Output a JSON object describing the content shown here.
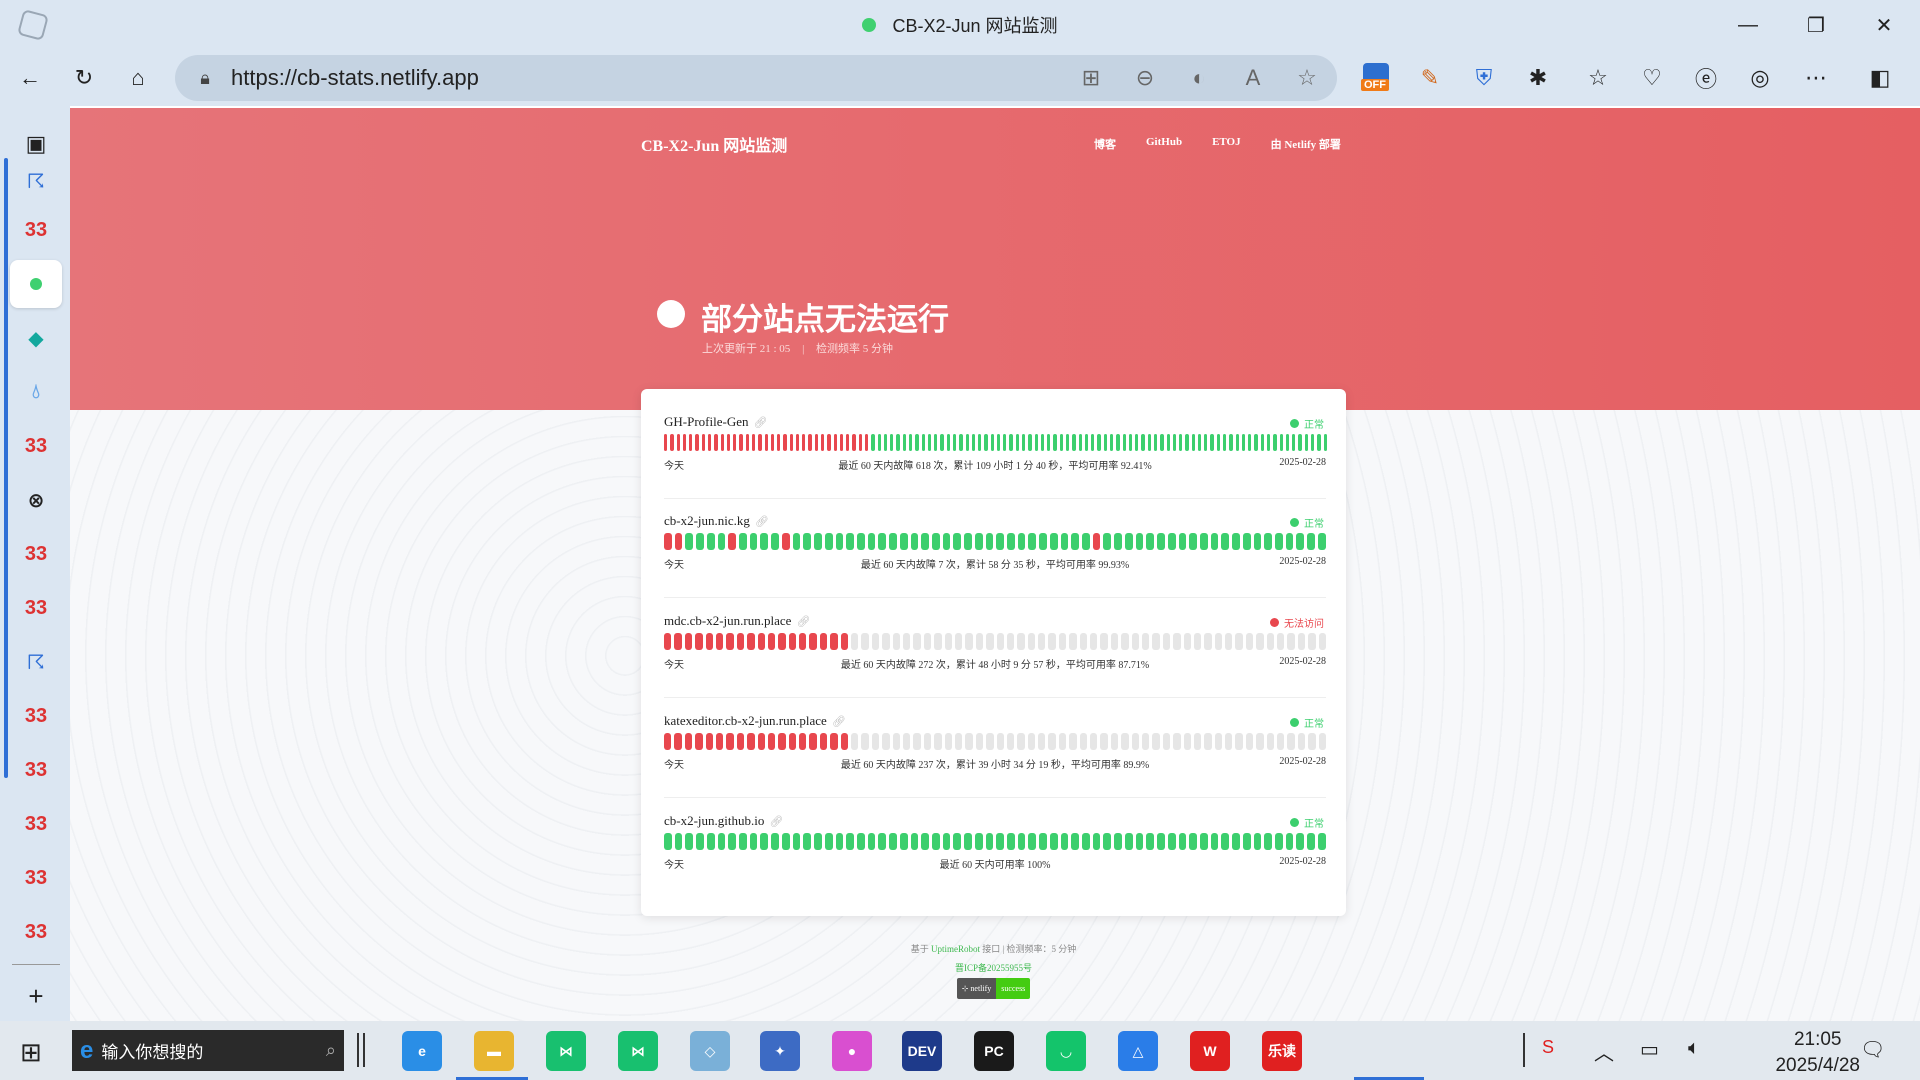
{
  "window": {
    "title": "CB-X2-Jun 网站监测",
    "minimize": "—",
    "restore": "❐",
    "close": "✕"
  },
  "toolbar": {
    "url": "https://cb-stats.netlify.app",
    "ext_off_badge": "OFF"
  },
  "site_header": {
    "brand": "CB-X2-Jun 网站监测",
    "nav": [
      "博客",
      "GitHub",
      "ETOJ",
      "由 Netlify 部署"
    ]
  },
  "overall": {
    "title": "部分站点无法运行",
    "last_update": "上次更新于 21 : 05",
    "separator": "|",
    "frequency": "检测频率 5 分钟"
  },
  "colors": {
    "up": "#3ccf6e",
    "down": "#e8474e",
    "nodata": "#e6e6e6",
    "header_start": "#e67479",
    "header_end": "#e55f62"
  },
  "monitors": [
    {
      "name": "GH-Profile-Gen",
      "status": "正常",
      "status_color": "#3ccf6e",
      "left": "今天",
      "summary": "最近 60 天内故障 618 次，累计 109 小时 1 分 40 秒，平均可用率 92.41%",
      "right": "2025-02-28",
      "bars": "ddddddddddddddddddddddddddddddddduuuuuuuuuuuuuuuuuuuuuuuuuuuuuuuuuuuuuuuuuuuuuuuuuuuuuuuuuuuuuuuuuuuuuuuuu"
    },
    {
      "name": "cb-x2-jun.nic.kg",
      "status": "正常",
      "status_color": "#3ccf6e",
      "left": "今天",
      "summary": "最近 60 天内故障 7 次，累计 58 分 35 秒，平均可用率 99.93%",
      "right": "2025-02-28",
      "bars": "dduuuuduuuuduuuuuuuuuuuuuuuuuuuuuuuuuuuuduuuuuuuuuuuuuuuuuuuuu"
    },
    {
      "name": "mdc.cb-x2-jun.run.place",
      "status": "无法访问",
      "status_color": "#e8474e",
      "left": "今天",
      "summary": "最近 60 天内故障 272 次，累计 48 小时 9 分 57 秒，平均可用率 87.71%",
      "right": "2025-02-28",
      "bars": "ddddddddddddddddddnnnnnnnnnnnnnnnnnnnnnnnnnnnnnnnnnnnnnnnnnnnnnn"
    },
    {
      "name": "katexeditor.cb-x2-jun.run.place",
      "status": "正常",
      "status_color": "#3ccf6e",
      "left": "今天",
      "summary": "最近 60 天内故障 237 次，累计 39 小时 34 分 19 秒，平均可用率 89.9%",
      "right": "2025-02-28",
      "bars": "ddddddddddddddddddnnnnnnnnnnnnnnnnnnnnnnnnnnnnnnnnnnnnnnnnnnnnnn"
    },
    {
      "name": "cb-x2-jun.github.io",
      "status": "正常",
      "status_color": "#3ccf6e",
      "left": "今天",
      "summary": "最近 60 天内可用率 100%",
      "right": "2025-02-28",
      "bars": "uuuuuuuuuuuuuuuuuuuuuuuuuuuuuuuuuuuuuuuuuuuuuuuuuuuuuuuuuuuuuu"
    }
  ],
  "page_footer": {
    "line1_prefix": "基于",
    "line1_link": "UptimeRobot",
    "line1_suffix": "接口 | 检测频率：5 分钟",
    "icp": "晋ICP备20255955号",
    "badge_left": "⊹ netlify",
    "badge_right": "success"
  },
  "taskbar": {
    "search_placeholder": "输入你想搜的",
    "time": "21:05",
    "date": "2025/4/28",
    "apps": [
      {
        "label": "e",
        "color": "#2a8ee6"
      },
      {
        "label": "▬",
        "color": "#e8b530"
      },
      {
        "label": "⋈",
        "color": "#18c06f"
      },
      {
        "label": "⋈",
        "color": "#18c06f"
      },
      {
        "label": "◇",
        "color": "#7ab0d8"
      },
      {
        "label": "✦",
        "color": "#3d6bc4"
      },
      {
        "label": "●",
        "color": "#d94fd0"
      },
      {
        "label": "DEV",
        "color": "#1e3a8a"
      },
      {
        "label": "PC",
        "color": "#1a1a1a"
      },
      {
        "label": "◡",
        "color": "#14c46b"
      },
      {
        "label": "△",
        "color": "#2a7de8"
      },
      {
        "label": "W",
        "color": "#e02020"
      },
      {
        "label": "乐读",
        "color": "#e02020"
      }
    ]
  }
}
